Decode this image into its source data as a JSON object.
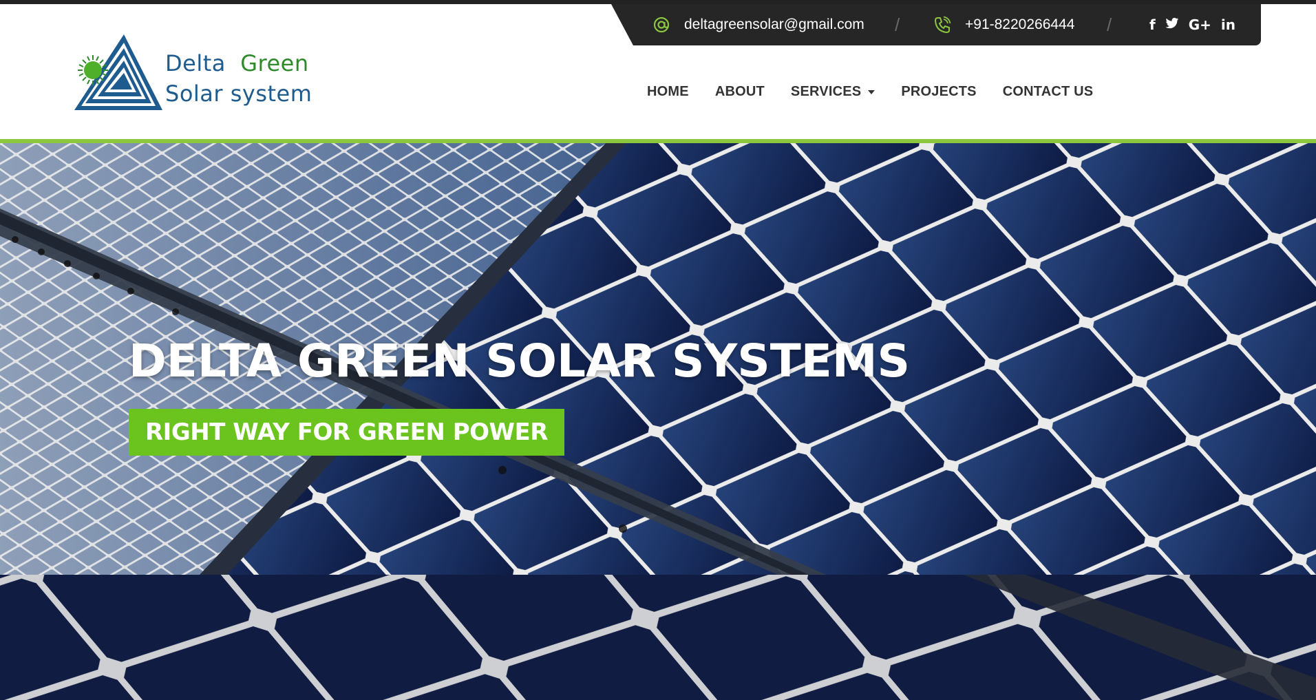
{
  "brand": {
    "logo_line1_a": "Delta",
    "logo_line1_b": "Green",
    "logo_line2": "Solar system",
    "colors": {
      "blue": "#1e5b8f",
      "green": "#2f8a2a",
      "sun": "#6bc31e"
    }
  },
  "topbar": {
    "email": "deltagreensolar@gmail.com",
    "email_icon": "at-icon",
    "phone": "+91-8220266444",
    "phone_icon": "phone-icon",
    "separator": "/",
    "social": [
      {
        "name": "facebook-icon",
        "glyph": "f"
      },
      {
        "name": "twitter-icon",
        "glyph": "t"
      },
      {
        "name": "google-plus-icon",
        "glyph": "G+"
      },
      {
        "name": "linkedin-icon",
        "glyph": "in"
      }
    ]
  },
  "nav": {
    "items": [
      {
        "label": "HOME"
      },
      {
        "label": "ABOUT"
      },
      {
        "label": "SERVICES"
      },
      {
        "label": "PROJECTS"
      },
      {
        "label": "CONTACT US"
      }
    ]
  },
  "hero": {
    "title": "DELTA GREEN SOLAR SYSTEMS",
    "tagline": "RIGHT WAY FOR GREEN POWER"
  },
  "colors": {
    "accent_green": "#8dc63f",
    "badge_green": "#6bc31e",
    "topbar_bg": "#262626",
    "nav_text": "#333333"
  }
}
